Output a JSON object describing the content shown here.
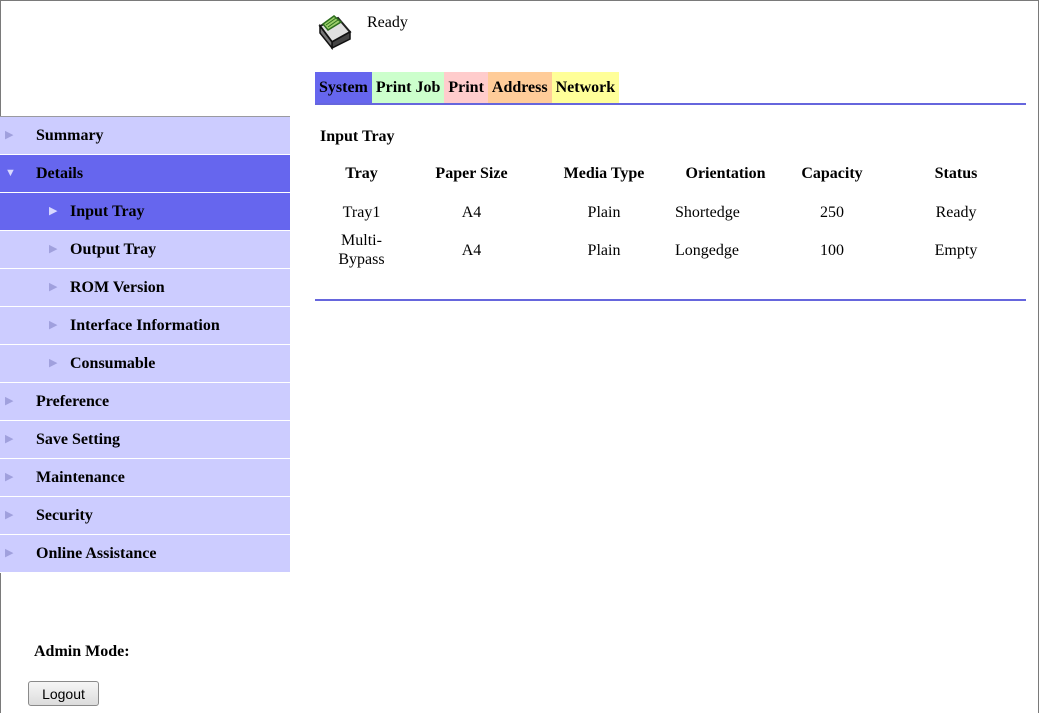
{
  "status": {
    "text": "Ready",
    "icon": "printer-icon"
  },
  "tabs": [
    {
      "label": "System",
      "color": "#6666ee"
    },
    {
      "label": "Print Job",
      "color": "#ccffcc"
    },
    {
      "label": "Print",
      "color": "#ffcccc"
    },
    {
      "label": "Address",
      "color": "#ffcc99"
    },
    {
      "label": "Network",
      "color": "#ffff99"
    }
  ],
  "sidebar": {
    "items": [
      {
        "label": "Summary"
      },
      {
        "label": "Details",
        "active": true
      },
      {
        "label": "Input Tray",
        "active": true
      },
      {
        "label": "Output Tray"
      },
      {
        "label": "ROM Version"
      },
      {
        "label": "Interface Information"
      },
      {
        "label": "Consumable"
      },
      {
        "label": "Preference"
      },
      {
        "label": "Save Setting"
      },
      {
        "label": "Maintenance"
      },
      {
        "label": "Security"
      },
      {
        "label": "Online Assistance"
      }
    ],
    "admin_label": "Admin Mode:",
    "logout_label": "Logout"
  },
  "main": {
    "title": "Input Tray",
    "table": {
      "headers": [
        "Tray",
        "Paper Size",
        "Media Type",
        "Orientation",
        "Capacity",
        "Status"
      ],
      "rows": [
        [
          "Tray1",
          "A4",
          "Plain",
          "Shortedge",
          "250",
          "Ready"
        ],
        [
          "Multi-\nBypass",
          "A4",
          "Plain",
          "Longedge",
          "100",
          "Empty"
        ]
      ]
    }
  },
  "colors": {
    "accent": "#6666ee",
    "nav_bg": "#ccccff",
    "rule": "#6666dd"
  }
}
